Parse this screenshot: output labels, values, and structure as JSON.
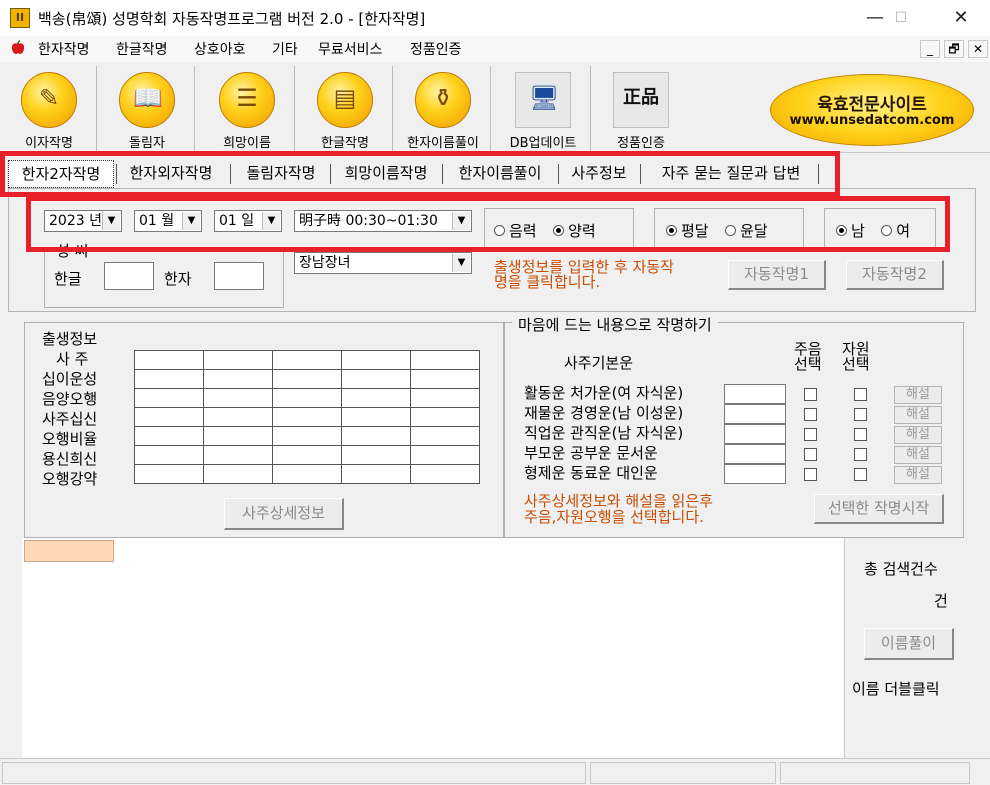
{
  "window": {
    "title": "백송(帛頌) 성명학회 자동작명프로그램 버전 2.0 - [한자작명]",
    "app_icon_text": "II",
    "minimize": "—",
    "maximize": "☐",
    "close": "✕"
  },
  "menu": {
    "items": [
      "한자작명",
      "한글작명",
      "상호아호",
      "기타",
      "무료서비스",
      "정품인증"
    ],
    "mdi": [
      "_",
      "🗗",
      "✕"
    ]
  },
  "toolbar": {
    "items": [
      {
        "label": "이자작명",
        "icon": "brush-paper-icon",
        "glyph": "✎"
      },
      {
        "label": "돌림자",
        "icon": "book-icon",
        "glyph": "📖"
      },
      {
        "label": "희망이름",
        "icon": "books-stack-icon",
        "glyph": "☰"
      },
      {
        "label": "한글작명",
        "icon": "notebook-icon",
        "glyph": "▤"
      },
      {
        "label": "한자이름풀이",
        "icon": "jar-icon",
        "glyph": "⚱"
      },
      {
        "label": "DB업데이트",
        "icon": "computer-globe-icon",
        "glyph": "🖥"
      },
      {
        "label": "정품인증",
        "icon": "genuine-stamp-icon",
        "glyph": "正品"
      }
    ],
    "brand_title": "육효전문사이트",
    "brand_url": "www.unsedatcom.com"
  },
  "tabs": [
    "한자2자작명",
    "한자외자작명",
    "돌림자작명",
    "희망이름작명",
    "한자이름풀이",
    "사주정보",
    "자주 묻는 질문과 답변"
  ],
  "birth": {
    "year": "2023 년",
    "month": "01 월",
    "day": "01 일",
    "time": "明子時 00:30~01:30",
    "calendar": [
      "음력",
      "양력"
    ],
    "calendar_selected": 1,
    "leap": [
      "평달",
      "윤달"
    ],
    "leap_selected": 0,
    "gender": [
      "남",
      "여"
    ],
    "gender_selected": 0
  },
  "surname": {
    "group_label": "성 씨",
    "hangul_label": "한글",
    "hanja_label": "한자",
    "hangul_value": "",
    "hanja_value": ""
  },
  "style_select": "장남장녀",
  "auto": {
    "hint_line1": "출생정보를 입력한 후 자동작",
    "hint_line2": "명을 클릭합니다.",
    "button1": "자동작명1",
    "button2": "자동작명2"
  },
  "saju": {
    "labels": [
      "출생정보",
      "사 주",
      "십이운성",
      "음양오행",
      "사주십신",
      "오행비율",
      "용신희신",
      "오행강약"
    ],
    "detail_button": "사주상세정보"
  },
  "pick": {
    "group_label": "마음에 드는 내용으로 작명하기",
    "header": "사주기본운",
    "col1": [
      "주음",
      "선택"
    ],
    "col2": [
      "자원",
      "선택"
    ],
    "rows": [
      "활동운 처가운(여 자식운)",
      "재물운 경영운(남 이성운)",
      "직업운 관직운(남 자식운)",
      "부모운 공부운 문서운",
      "형제운 동료운 대인운"
    ],
    "explain_button": "해설",
    "hint_line1": "사주상세정보와 해설을 읽은후",
    "hint_line2": "주음,자원오행을 선택합니다.",
    "start_button": "선택한 작명시작"
  },
  "results": {
    "total_label": "총 검색건수",
    "count_unit": "건",
    "name_button": "이름풀이",
    "dblclick_hint": "이름 더블클릭"
  },
  "colors": {
    "highlight_red": "#e8202a",
    "hint_orange": "#c84b00",
    "header_peach": "#ffd8b8",
    "brand_gold": "#ffd21a"
  }
}
